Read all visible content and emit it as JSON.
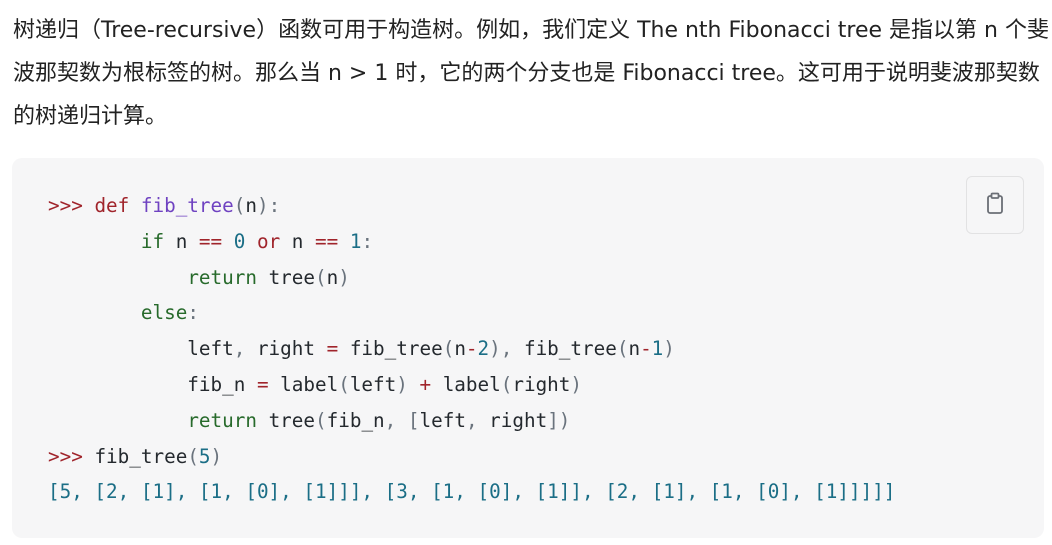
{
  "intro": {
    "text": "树递归（Tree-recursive）函数可用于构造树。例如，我们定义 The nth Fibonacci tree 是指以第 n 个斐波那契数为根标签的树。那么当 n > 1 时，它的两个分支也是 Fibonacci tree。这可用于说明斐波那契数的树递归计算。"
  },
  "copy_button": {
    "icon": "clipboard-icon"
  },
  "code": {
    "lines": [
      [
        [
          "tok-prompt",
          ">>> "
        ],
        [
          "tok-kw",
          "def "
        ],
        [
          "tok-def",
          "fib_tree"
        ],
        [
          "tok-punc",
          "("
        ],
        [
          "tok-name",
          "n"
        ],
        [
          "tok-punc",
          "):"
        ]
      ],
      [
        [
          "tok-name",
          "        "
        ],
        [
          "tok-kw2",
          "if "
        ],
        [
          "tok-name",
          "n "
        ],
        [
          "tok-op",
          "== "
        ],
        [
          "tok-num",
          "0 "
        ],
        [
          "tok-op",
          "or "
        ],
        [
          "tok-name",
          "n "
        ],
        [
          "tok-op",
          "== "
        ],
        [
          "tok-num",
          "1"
        ],
        [
          "tok-punc",
          ":"
        ]
      ],
      [
        [
          "tok-name",
          "            "
        ],
        [
          "tok-kw2",
          "return "
        ],
        [
          "tok-call",
          "tree"
        ],
        [
          "tok-punc",
          "("
        ],
        [
          "tok-name",
          "n"
        ],
        [
          "tok-punc",
          ")"
        ]
      ],
      [
        [
          "tok-name",
          "        "
        ],
        [
          "tok-kw2",
          "else"
        ],
        [
          "tok-punc",
          ":"
        ]
      ],
      [
        [
          "tok-name",
          "            left"
        ],
        [
          "tok-punc",
          ", "
        ],
        [
          "tok-name",
          "right "
        ],
        [
          "tok-op",
          "= "
        ],
        [
          "tok-call",
          "fib_tree"
        ],
        [
          "tok-punc",
          "("
        ],
        [
          "tok-name",
          "n"
        ],
        [
          "tok-op",
          "-"
        ],
        [
          "tok-num",
          "2"
        ],
        [
          "tok-punc",
          "), "
        ],
        [
          "tok-call",
          "fib_tree"
        ],
        [
          "tok-punc",
          "("
        ],
        [
          "tok-name",
          "n"
        ],
        [
          "tok-op",
          "-"
        ],
        [
          "tok-num",
          "1"
        ],
        [
          "tok-punc",
          ")"
        ]
      ],
      [
        [
          "tok-name",
          "            fib_n "
        ],
        [
          "tok-op",
          "= "
        ],
        [
          "tok-call",
          "label"
        ],
        [
          "tok-punc",
          "("
        ],
        [
          "tok-name",
          "left"
        ],
        [
          "tok-punc",
          ") "
        ],
        [
          "tok-op",
          "+ "
        ],
        [
          "tok-call",
          "label"
        ],
        [
          "tok-punc",
          "("
        ],
        [
          "tok-name",
          "right"
        ],
        [
          "tok-punc",
          ")"
        ]
      ],
      [
        [
          "tok-name",
          "            "
        ],
        [
          "tok-kw2",
          "return "
        ],
        [
          "tok-call",
          "tree"
        ],
        [
          "tok-punc",
          "("
        ],
        [
          "tok-name",
          "fib_n"
        ],
        [
          "tok-punc",
          ", ["
        ],
        [
          "tok-name",
          "left"
        ],
        [
          "tok-punc",
          ", "
        ],
        [
          "tok-name",
          "right"
        ],
        [
          "tok-punc",
          "])"
        ]
      ],
      [
        [
          "tok-prompt",
          ">>> "
        ],
        [
          "tok-call",
          "fib_tree"
        ],
        [
          "tok-punc",
          "("
        ],
        [
          "tok-num",
          "5"
        ],
        [
          "tok-punc",
          ")"
        ]
      ],
      [
        [
          "tok-out",
          "[5, [2, [1], [1, [0], [1]]], [3, [1, [0], [1]], [2, [1], [1, [0], [1]]]]]"
        ]
      ]
    ]
  }
}
